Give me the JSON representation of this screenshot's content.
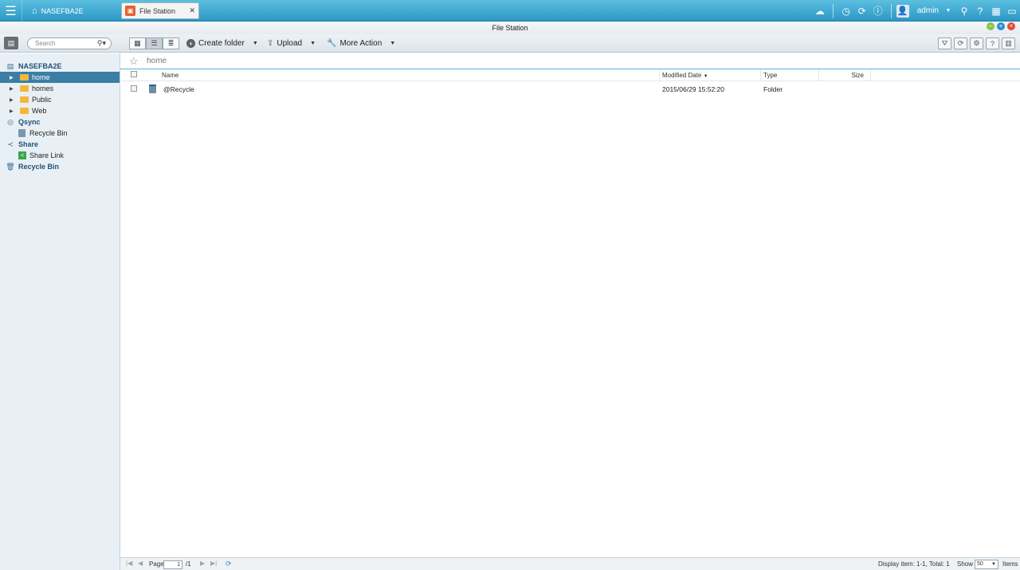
{
  "taskbar": {
    "home_label": "NASEFBA2E",
    "app_tab_label": "File Station",
    "username": "admin"
  },
  "window": {
    "title": "File Station"
  },
  "toolbar": {
    "search_placeholder": "Search",
    "create_folder_label": "Create folder",
    "upload_label": "Upload",
    "more_action_label": "More Action"
  },
  "sidebar": {
    "root_label": "NASEFBA2E",
    "folders": [
      "home",
      "homes",
      "Public",
      "Web"
    ],
    "selected_folder": "home",
    "qsync_label": "Qsync",
    "qsync_recycle_label": "Recycle Bin",
    "share_label": "Share",
    "share_link_label": "Share Link",
    "recycle_bin_label": "Recycle Bin"
  },
  "path": {
    "current": "home"
  },
  "grid": {
    "columns": {
      "name": "Name",
      "modified": "Modified Date",
      "type": "Type",
      "size": "Size"
    },
    "rows": [
      {
        "name": "@Recycle",
        "modified": "2015/06/29 15:52:20",
        "type": "Folder",
        "size": ""
      }
    ]
  },
  "footer": {
    "page_label": "Page",
    "page_value": "1",
    "page_total": "/1",
    "display_info": "Display item: 1-1, Total: 1",
    "show_label": "Show",
    "show_value": "50",
    "items_label": "Items"
  },
  "colors": {
    "taskbar": "#2d97c4",
    "selection": "#3a7ea6",
    "accent_line": "#58b7d4"
  }
}
